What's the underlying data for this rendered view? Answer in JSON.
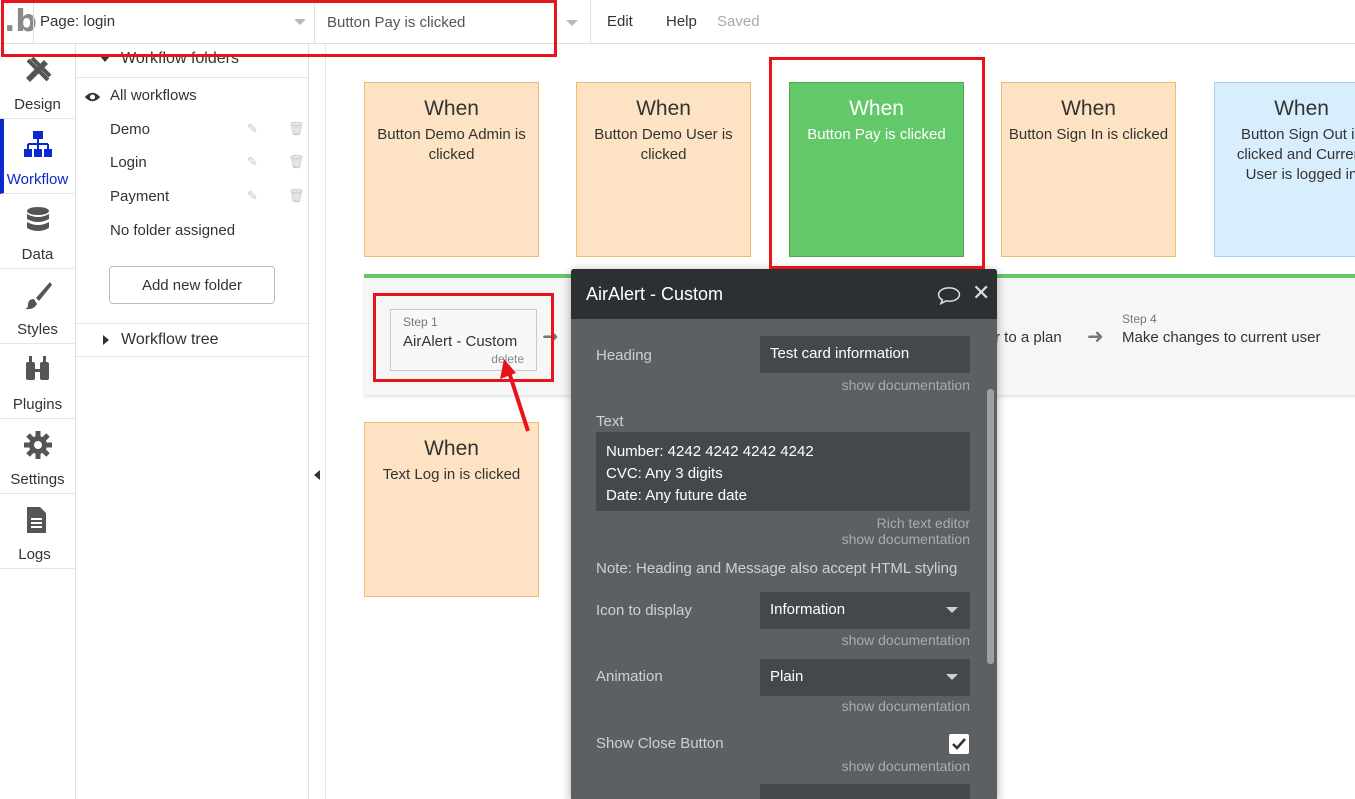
{
  "topbar": {
    "logo": ".b",
    "page_select": "Page: login",
    "workflow_select": "Button Pay is clicked",
    "menu": {
      "edit": "Edit",
      "help": "Help"
    },
    "status": "Saved"
  },
  "nav": {
    "items": [
      {
        "label": "Design",
        "icon": "design-icon"
      },
      {
        "label": "Workflow",
        "icon": "workflow-icon"
      },
      {
        "label": "Data",
        "icon": "database-icon"
      },
      {
        "label": "Styles",
        "icon": "brush-icon"
      },
      {
        "label": "Plugins",
        "icon": "plug-icon"
      },
      {
        "label": "Settings",
        "icon": "gear-icon"
      },
      {
        "label": "Logs",
        "icon": "document-icon"
      }
    ]
  },
  "folders": {
    "header": "Workflow folders",
    "all": "All workflows",
    "items": [
      {
        "label": "Demo"
      },
      {
        "label": "Login"
      },
      {
        "label": "Payment"
      }
    ],
    "unassigned": "No folder assigned",
    "add_button": "Add new folder",
    "tree": "Workflow tree"
  },
  "events": [
    {
      "when": "When",
      "desc": "Button Demo Admin is clicked"
    },
    {
      "when": "When",
      "desc": "Button Demo User is clicked"
    },
    {
      "when": "When",
      "desc": "Button Pay is clicked"
    },
    {
      "when": "When",
      "desc": "Button Sign In is clicked"
    },
    {
      "when": "When",
      "desc": "Button Sign Out is clicked and Current User is logged in"
    },
    {
      "when": "When",
      "desc": "Text Log in is clicked"
    }
  ],
  "steps": {
    "step1": {
      "number": "Step 1",
      "title": "AirAlert - Custom",
      "delete": "delete"
    },
    "step3_partial": "r to a plan",
    "step4": {
      "number": "Step 4",
      "title": "Make changes to current user"
    }
  },
  "editor": {
    "title": "AirAlert - Custom",
    "doc": "show documentation",
    "heading_label": "Heading",
    "heading_value": "Test card information",
    "text_label": "Text",
    "text_lines": [
      "Number: 4242 4242 4242 4242",
      "CVC: Any 3 digits",
      "Date: Any future date"
    ],
    "rich_text": "Rich text editor",
    "note": "Note: Heading and Message also accept HTML styling",
    "icon_label": "Icon to display",
    "icon_value": "Information",
    "animation_label": "Animation",
    "animation_value": "Plain",
    "close_label": "Show Close Button",
    "close_checked": true
  },
  "colors": {
    "accent": "#0c29d0",
    "highlight": "#e8141c",
    "event_orange": "#fde3c3",
    "event_active": "#62c86a",
    "event_blue": "#d9eefd"
  }
}
